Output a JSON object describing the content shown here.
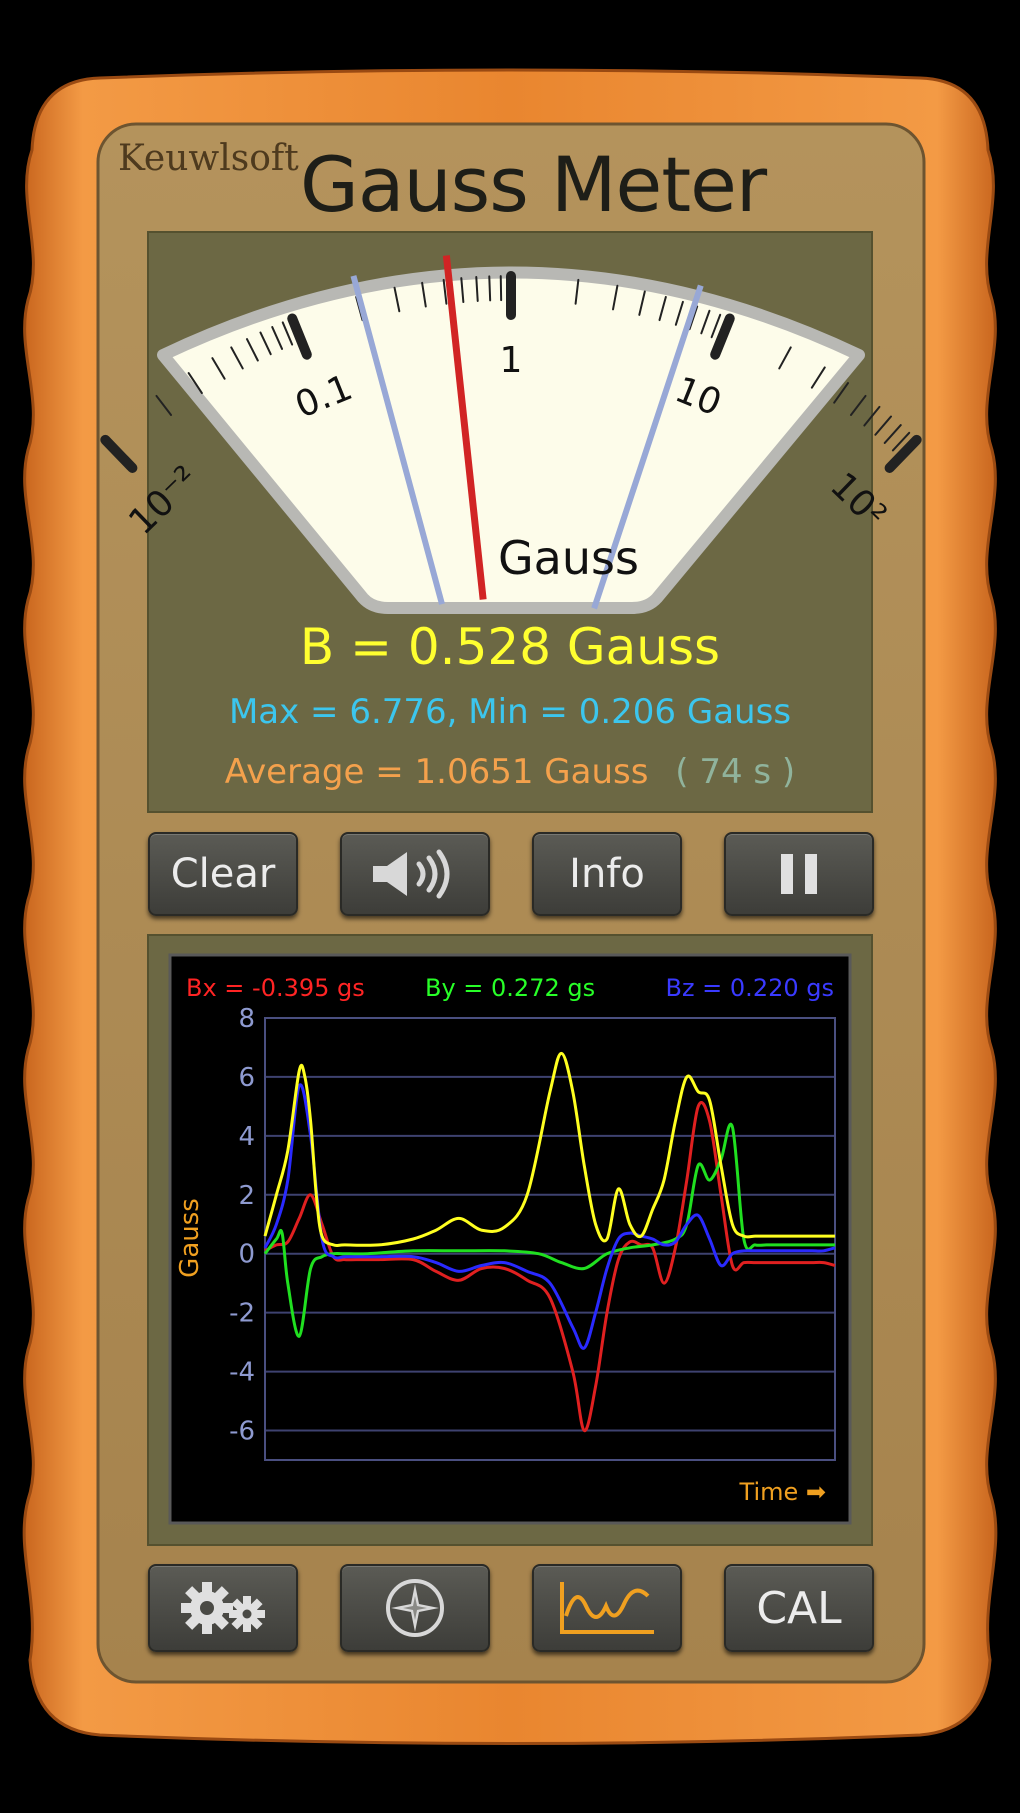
{
  "app": {
    "brand": "Keuwlsoft",
    "title": "Gauss Meter"
  },
  "meter": {
    "unit": "Gauss",
    "scale_labels": [
      "10⁻²",
      "0.1",
      "1",
      "10",
      "10²"
    ],
    "needle_value": 0.528,
    "max_marker_value": 6.776,
    "min_marker_value": 0.206
  },
  "readouts": {
    "b_text": "B = 0.528 Gauss",
    "maxmin_text": "Max = 6.776,  Min = 0.206 Gauss",
    "average_text": "Average = 1.0651 Gauss",
    "elapsed_text": "( 74 s )"
  },
  "buttons": {
    "clear": "Clear",
    "info": "Info",
    "cal": "CAL"
  },
  "graph": {
    "bx_text": "Bx = -0.395 gs",
    "by_text": "By = 0.272 gs",
    "bz_text": "Bz = 0.220 gs",
    "ylabel": "Gauss",
    "time_label": "Time ➡",
    "y_ticks": [
      "8",
      "6",
      "4",
      "2",
      "0",
      "-2",
      "-4",
      "-6"
    ]
  },
  "chart_data": {
    "type": "line",
    "ylim": [
      -7,
      8
    ],
    "ylabel": "Gauss",
    "xlabel": "Time",
    "grid": true,
    "series": [
      {
        "name": "Bx",
        "color": "#e02020",
        "x": [
          0,
          2,
          4,
          6,
          8,
          10,
          12,
          14,
          16,
          20,
          26,
          30,
          34,
          38,
          42,
          46,
          50,
          54,
          56,
          58,
          60,
          62,
          64,
          66,
          68,
          70,
          72,
          74,
          76,
          78,
          80,
          82,
          84,
          86,
          88,
          90,
          92,
          94,
          96,
          98,
          100
        ],
        "y": [
          0.1,
          0.3,
          0.4,
          1.2,
          2.0,
          1.0,
          -0.1,
          -0.2,
          -0.2,
          -0.2,
          -0.2,
          -0.6,
          -0.9,
          -0.5,
          -0.5,
          -0.9,
          -1.5,
          -4.0,
          -6.0,
          -4.5,
          -2.0,
          -0.2,
          0.4,
          0.3,
          0.2,
          -1.0,
          0.2,
          2.5,
          5.0,
          4.5,
          2.0,
          -0.4,
          -0.3,
          -0.3,
          -0.3,
          -0.3,
          -0.3,
          -0.3,
          -0.3,
          -0.3,
          -0.4
        ]
      },
      {
        "name": "By",
        "color": "#20e020",
        "x": [
          0,
          2,
          3,
          4,
          6,
          8,
          10,
          12,
          14,
          18,
          26,
          34,
          42,
          48,
          52,
          56,
          60,
          64,
          68,
          72,
          74,
          76,
          78,
          80,
          82,
          84,
          86,
          88,
          90,
          92,
          94,
          96,
          98,
          100
        ],
        "y": [
          0.0,
          0.5,
          0.7,
          -1.0,
          -2.8,
          -0.5,
          -0.1,
          0.0,
          0.0,
          0.0,
          0.1,
          0.1,
          0.1,
          0.0,
          -0.3,
          -0.5,
          0.0,
          0.2,
          0.3,
          0.5,
          1.0,
          3.0,
          2.5,
          3.2,
          4.3,
          0.5,
          0.3,
          0.3,
          0.3,
          0.3,
          0.3,
          0.3,
          0.3,
          0.3
        ]
      },
      {
        "name": "Bz",
        "color": "#2a2aff",
        "x": [
          0,
          2,
          4,
          6,
          8,
          10,
          12,
          14,
          16,
          20,
          26,
          30,
          34,
          38,
          42,
          46,
          50,
          54,
          56,
          58,
          60,
          62,
          64,
          66,
          68,
          70,
          72,
          74,
          76,
          78,
          80,
          82,
          84,
          86,
          88,
          90,
          92,
          94,
          96,
          98,
          100
        ],
        "y": [
          0.2,
          1.0,
          2.5,
          5.7,
          4.0,
          0.5,
          -0.1,
          -0.1,
          -0.1,
          -0.1,
          -0.1,
          -0.3,
          -0.6,
          -0.4,
          -0.3,
          -0.6,
          -1.0,
          -2.5,
          -3.2,
          -2.0,
          -0.5,
          0.5,
          0.7,
          0.6,
          0.5,
          0.3,
          0.4,
          1.0,
          1.3,
          0.5,
          -0.4,
          0.0,
          0.1,
          0.1,
          0.1,
          0.1,
          0.1,
          0.1,
          0.1,
          0.1,
          0.2
        ]
      },
      {
        "name": "|B|",
        "color": "#ffff20",
        "x": [
          0,
          2,
          4,
          6,
          7,
          8,
          9,
          10,
          12,
          14,
          20,
          26,
          30,
          34,
          38,
          42,
          46,
          50,
          52,
          54,
          56,
          58,
          60,
          62,
          64,
          66,
          68,
          70,
          72,
          74,
          76,
          78,
          80,
          82,
          84,
          86,
          88,
          90,
          92,
          94,
          96,
          98,
          100
        ],
        "y": [
          0.6,
          2.0,
          3.5,
          6.2,
          6.0,
          4.5,
          2.0,
          0.6,
          0.3,
          0.3,
          0.3,
          0.5,
          0.8,
          1.2,
          0.8,
          0.9,
          2.0,
          5.5,
          6.8,
          5.5,
          3.0,
          1.0,
          0.5,
          2.2,
          1.0,
          0.6,
          1.5,
          2.5,
          4.5,
          6.0,
          5.5,
          5.2,
          3.0,
          1.0,
          0.6,
          0.6,
          0.6,
          0.6,
          0.6,
          0.6,
          0.6,
          0.6,
          0.6
        ]
      }
    ]
  }
}
